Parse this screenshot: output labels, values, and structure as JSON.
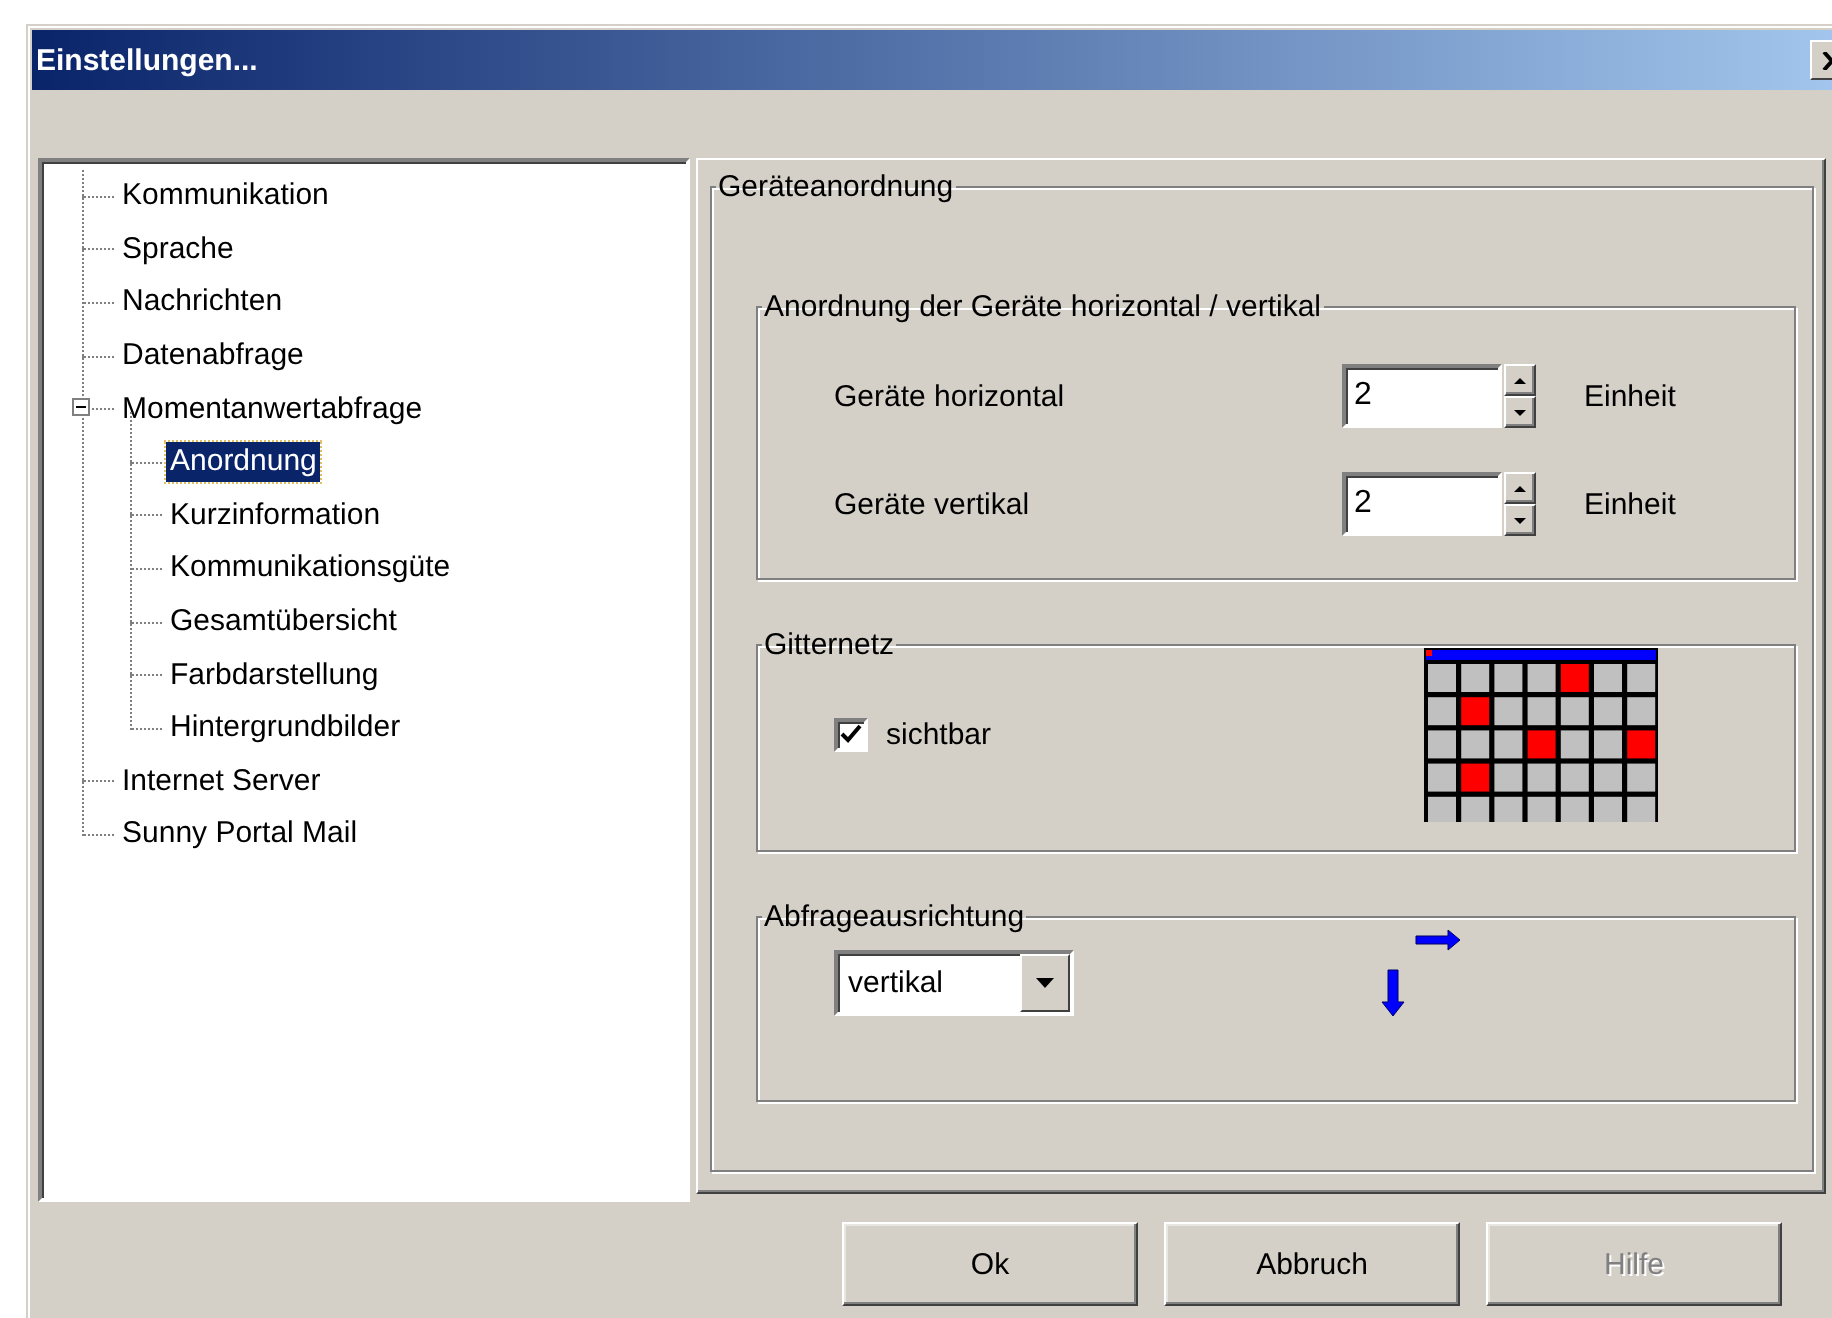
{
  "window": {
    "title": "Einstellungen..."
  },
  "tree": [
    {
      "label": "Kommunikation",
      "selected": false
    },
    {
      "label": "Sprache",
      "selected": false
    },
    {
      "label": "Nachrichten",
      "selected": false
    },
    {
      "label": "Datenabfrage",
      "selected": false
    },
    {
      "label": "Momentanwertabfrage",
      "selected": false,
      "expanded": true,
      "children": [
        {
          "label": "Anordnung",
          "selected": true
        },
        {
          "label": "Kurzinformation",
          "selected": false
        },
        {
          "label": "Kommunikationsgüte",
          "selected": false
        },
        {
          "label": "Gesamtübersicht",
          "selected": false
        },
        {
          "label": "Farbdarstellung",
          "selected": false
        },
        {
          "label": "Hintergrundbilder",
          "selected": false
        }
      ]
    },
    {
      "label": "Internet Server",
      "selected": false
    },
    {
      "label": "Sunny Portal Mail",
      "selected": false
    }
  ],
  "settings": {
    "title": "Geräteanordnung",
    "layout_group": {
      "title": "Anordnung der Geräte horizontal / vertikal",
      "fields": [
        {
          "label": "Geräte horizontal",
          "value": "2",
          "unit": "Einheit"
        },
        {
          "label": "Geräte vertikal",
          "value": "2",
          "unit": "Einheit"
        }
      ]
    },
    "grid_group": {
      "title": "Gitternetz",
      "checkbox": {
        "label": "sichtbar",
        "checked": true
      }
    },
    "orientation_group": {
      "title": "Abfrageausrichtung",
      "dropdown": {
        "value": "vertikal"
      }
    }
  },
  "buttons": [
    {
      "label": "Ok",
      "disabled": false
    },
    {
      "label": "Abbruch",
      "disabled": false
    },
    {
      "label": "Hilfe",
      "disabled": true
    }
  ]
}
